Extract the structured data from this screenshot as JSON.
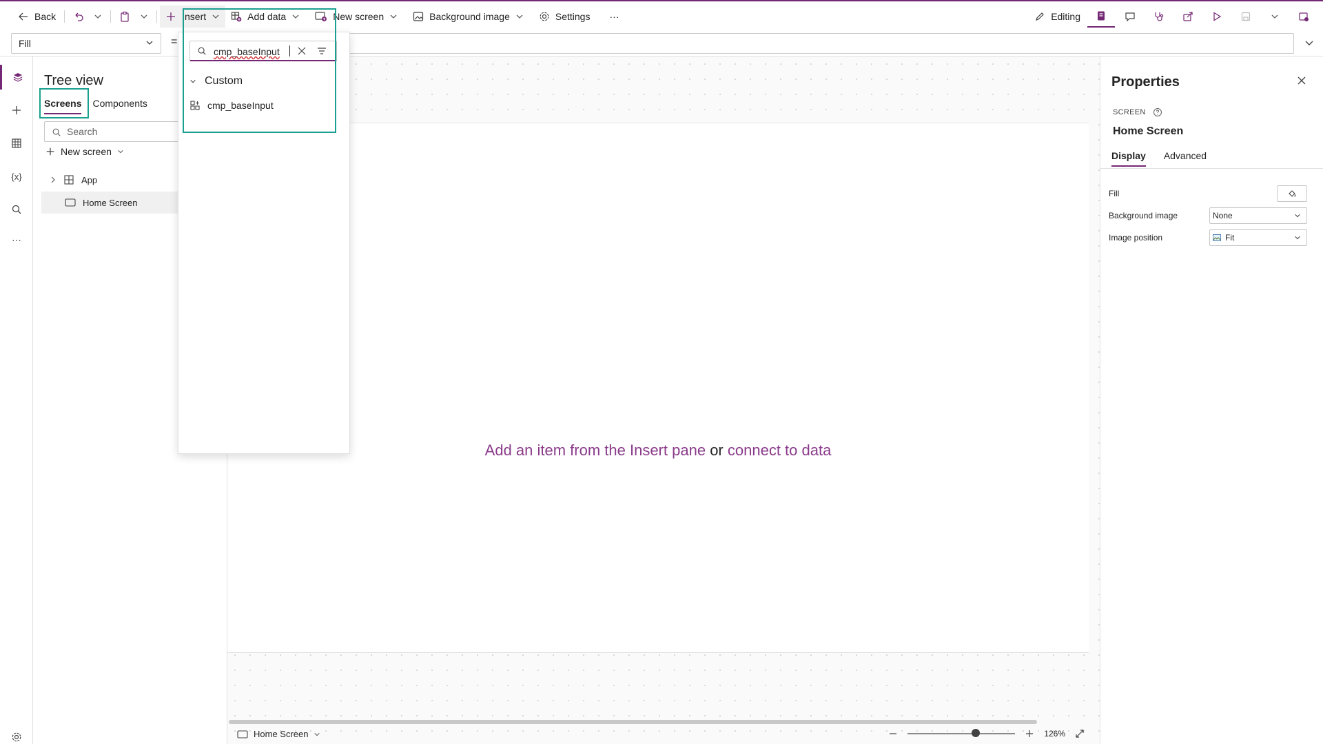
{
  "command_bar": {
    "back_label": "Back",
    "insert_label": "Insert",
    "add_data_label": "Add data",
    "new_screen_label": "New screen",
    "background_image_label": "Background image",
    "settings_label": "Settings",
    "more_label": "···",
    "editing_label": "Editing"
  },
  "formula_bar": {
    "property": "Fill",
    "equals": "="
  },
  "tree_view": {
    "title": "Tree view",
    "tabs": [
      "Screens",
      "Components"
    ],
    "search_placeholder": "Search",
    "new_screen_label": "New screen",
    "items": [
      {
        "label": "App"
      },
      {
        "label": "Home Screen"
      }
    ]
  },
  "insert_pane": {
    "search_value": "cmp_baseInput",
    "category": "Custom",
    "results": [
      "cmp_baseInput"
    ]
  },
  "canvas": {
    "hint_part1": "Add an item from the Insert pane",
    "hint_or": "or",
    "hint_part2": "connect to data"
  },
  "status_bar": {
    "screen_name": "Home Screen",
    "zoom": "126%"
  },
  "properties": {
    "title": "Properties",
    "type_label": "SCREEN",
    "name": "Home Screen",
    "tabs": [
      "Display",
      "Advanced"
    ],
    "rows": [
      {
        "label": "Fill"
      },
      {
        "label": "Background image",
        "value": "None"
      },
      {
        "label": "Image position",
        "value": "Fit"
      }
    ]
  },
  "colors": {
    "accent": "#742774",
    "highlight": "#1aa090",
    "canvas_link": "#8a3a8a"
  }
}
